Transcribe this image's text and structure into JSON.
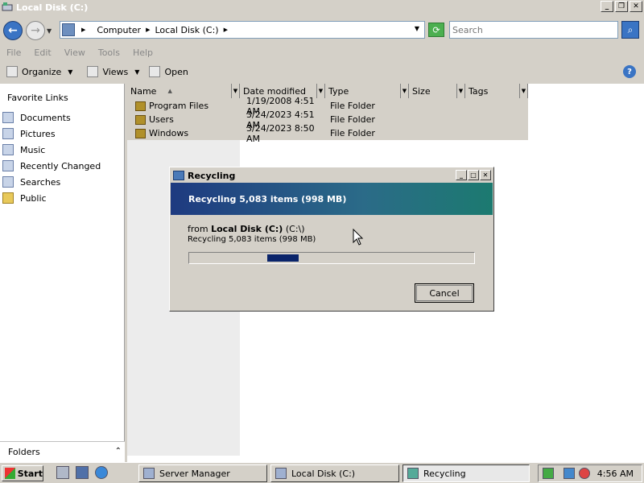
{
  "window": {
    "title": "Local Disk (C:)",
    "buttons": {
      "minimize": "_",
      "maximize": "❐",
      "close": "✕"
    }
  },
  "address": {
    "crumbs": [
      "Computer",
      "Local Disk (C:)"
    ],
    "search_placeholder": "Search"
  },
  "menu": [
    "File",
    "Edit",
    "View",
    "Tools",
    "Help"
  ],
  "toolbar": {
    "organize": "Organize",
    "views": "Views",
    "open": "Open"
  },
  "sidebar": {
    "header": "Favorite Links",
    "items": [
      {
        "label": "Documents",
        "icon": "documents-icon"
      },
      {
        "label": "Pictures",
        "icon": "pictures-icon"
      },
      {
        "label": "Music",
        "icon": "music-icon"
      },
      {
        "label": "Recently Changed",
        "icon": "recently-changed-icon"
      },
      {
        "label": "Searches",
        "icon": "searches-icon"
      },
      {
        "label": "Public",
        "icon": "folder-icon"
      }
    ],
    "folders_label": "Folders"
  },
  "columns": [
    "Name",
    "Date modified",
    "Type",
    "Size",
    "Tags"
  ],
  "files": [
    {
      "name": "Program Files",
      "date": "1/19/2008 4:51 AM",
      "type": "File Folder"
    },
    {
      "name": "Users",
      "date": "3/24/2023 4:51 AM",
      "type": "File Folder"
    },
    {
      "name": "Windows",
      "date": "3/24/2023 8:50 AM",
      "type": "File Folder"
    }
  ],
  "dialog": {
    "title": "Recycling",
    "banner": "Recycling 5,083 items (998 MB)",
    "from_prefix": "from",
    "from_bold": "Local Disk (C:)",
    "from_suffix": "(C:\\)",
    "status": "Recycling 5,083 items (998 MB)",
    "progress": {
      "fill_start": 0.27,
      "fill_end": 0.38
    },
    "cancel": "Cancel"
  },
  "taskbar": {
    "start": "Start",
    "tasks": [
      "Server Manager",
      "Local Disk (C:)",
      "Recycling"
    ],
    "clock": "4:56 AM"
  },
  "colors": {
    "banner_left": "#1e3a80",
    "banner_right": "#1c7a70",
    "progress_fill": "#0a246a"
  }
}
